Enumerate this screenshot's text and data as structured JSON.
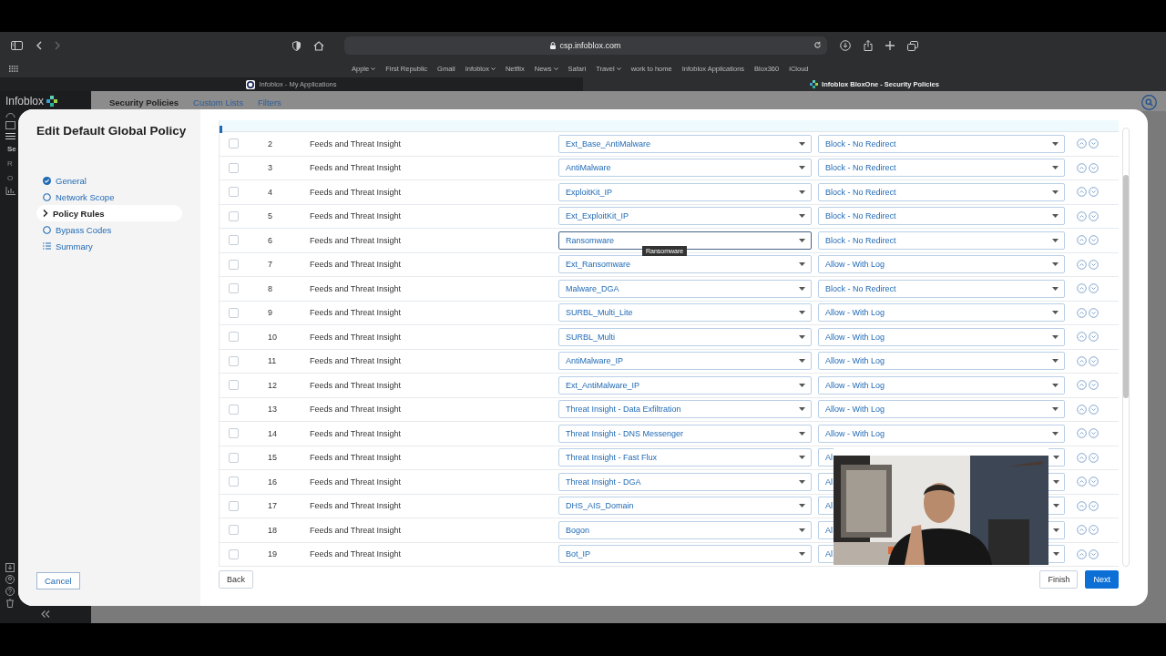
{
  "browser": {
    "address": "csp.infoblox.com",
    "bookmarks": [
      {
        "label": "Apple",
        "menu": true
      },
      {
        "label": "First Republic",
        "menu": false
      },
      {
        "label": "Gmail",
        "menu": false
      },
      {
        "label": "Infoblox",
        "menu": true
      },
      {
        "label": "Netflix",
        "menu": false
      },
      {
        "label": "News",
        "menu": true
      },
      {
        "label": "Safari",
        "menu": false
      },
      {
        "label": "Travel",
        "menu": true
      },
      {
        "label": "work to home",
        "menu": false
      },
      {
        "label": "Infoblox Applications",
        "menu": false
      },
      {
        "label": "Blox360",
        "menu": false
      },
      {
        "label": "iCloud",
        "menu": false
      }
    ],
    "tabs": [
      {
        "label": "Infoblox - My Applications",
        "selected": false
      },
      {
        "label": "Infoblox BloxOne - Security Policies",
        "selected": true
      }
    ]
  },
  "app": {
    "logo": "Infoblox",
    "nav_cut": [
      "Se",
      "R",
      "O"
    ],
    "header_tabs": [
      {
        "label": "Security Policies",
        "selected": true
      },
      {
        "label": "Custom Lists",
        "selected": false
      },
      {
        "label": "Filters",
        "selected": false
      }
    ]
  },
  "dialog": {
    "title": "Edit Default Global Policy",
    "steps": [
      {
        "label": "General",
        "kind": "done",
        "selected": false
      },
      {
        "label": "Network Scope",
        "kind": "pending",
        "selected": false
      },
      {
        "label": "Policy Rules",
        "kind": "current",
        "selected": true
      },
      {
        "label": "Bypass Codes",
        "kind": "pending",
        "selected": false
      },
      {
        "label": "Summary",
        "kind": "list",
        "selected": false
      }
    ],
    "cancel": "Cancel",
    "back": "Back",
    "finish": "Finish",
    "next": "Next",
    "rows": [
      {
        "num": "2",
        "type": "Feeds and Threat Insight",
        "feed": "Ext_Base_AntiMalware",
        "action": "Block - No Redirect",
        "checked": false,
        "focused": false
      },
      {
        "num": "3",
        "type": "Feeds and Threat Insight",
        "feed": "AntiMalware",
        "action": "Block - No Redirect",
        "checked": false,
        "focused": false
      },
      {
        "num": "4",
        "type": "Feeds and Threat Insight",
        "feed": "ExploitKit_IP",
        "action": "Block - No Redirect",
        "checked": false,
        "focused": false
      },
      {
        "num": "5",
        "type": "Feeds and Threat Insight",
        "feed": "Ext_ExploitKit_IP",
        "action": "Block - No Redirect",
        "checked": false,
        "focused": false
      },
      {
        "num": "6",
        "type": "Feeds and Threat Insight",
        "feed": "Ransomware",
        "action": "Block - No Redirect",
        "checked": false,
        "focused": true,
        "tooltip": "Ransomware"
      },
      {
        "num": "7",
        "type": "Feeds and Threat Insight",
        "feed": "Ext_Ransomware",
        "action": "Allow - With Log",
        "checked": false,
        "focused": false
      },
      {
        "num": "8",
        "type": "Feeds and Threat Insight",
        "feed": "Malware_DGA",
        "action": "Block - No Redirect",
        "checked": false,
        "focused": false
      },
      {
        "num": "9",
        "type": "Feeds and Threat Insight",
        "feed": "SURBL_Multi_Lite",
        "action": "Allow - With Log",
        "checked": false,
        "focused": false
      },
      {
        "num": "10",
        "type": "Feeds and Threat Insight",
        "feed": "SURBL_Multi",
        "action": "Allow - With Log",
        "checked": false,
        "focused": false
      },
      {
        "num": "11",
        "type": "Feeds and Threat Insight",
        "feed": "AntiMalware_IP",
        "action": "Allow - With Log",
        "checked": false,
        "focused": false
      },
      {
        "num": "12",
        "type": "Feeds and Threat Insight",
        "feed": "Ext_AntiMalware_IP",
        "action": "Allow - With Log",
        "checked": false,
        "focused": false
      },
      {
        "num": "13",
        "type": "Feeds and Threat Insight",
        "feed": "Threat Insight - Data Exfiltration",
        "action": "Allow - With Log",
        "checked": false,
        "focused": false
      },
      {
        "num": "14",
        "type": "Feeds and Threat Insight",
        "feed": "Threat Insight - DNS Messenger",
        "action": "Allow - With Log",
        "checked": false,
        "focused": false
      },
      {
        "num": "15",
        "type": "Feeds and Threat Insight",
        "feed": "Threat Insight - Fast Flux",
        "action": "Al",
        "action_cut": true,
        "checked": false,
        "focused": false
      },
      {
        "num": "16",
        "type": "Feeds and Threat Insight",
        "feed": "Threat Insight - DGA",
        "action": "Al",
        "action_cut": true,
        "checked": false,
        "focused": false
      },
      {
        "num": "17",
        "type": "Feeds and Threat Insight",
        "feed": "DHS_AIS_Domain",
        "action": "Al",
        "action_cut": true,
        "checked": false,
        "focused": false
      },
      {
        "num": "18",
        "type": "Feeds and Threat Insight",
        "feed": "Bogon",
        "action": "Al",
        "action_cut": true,
        "checked": false,
        "focused": false
      },
      {
        "num": "19",
        "type": "Feeds and Threat Insight",
        "feed": "Bot_IP",
        "action": "Al",
        "action_cut": true,
        "checked": false,
        "focused": false
      }
    ]
  }
}
